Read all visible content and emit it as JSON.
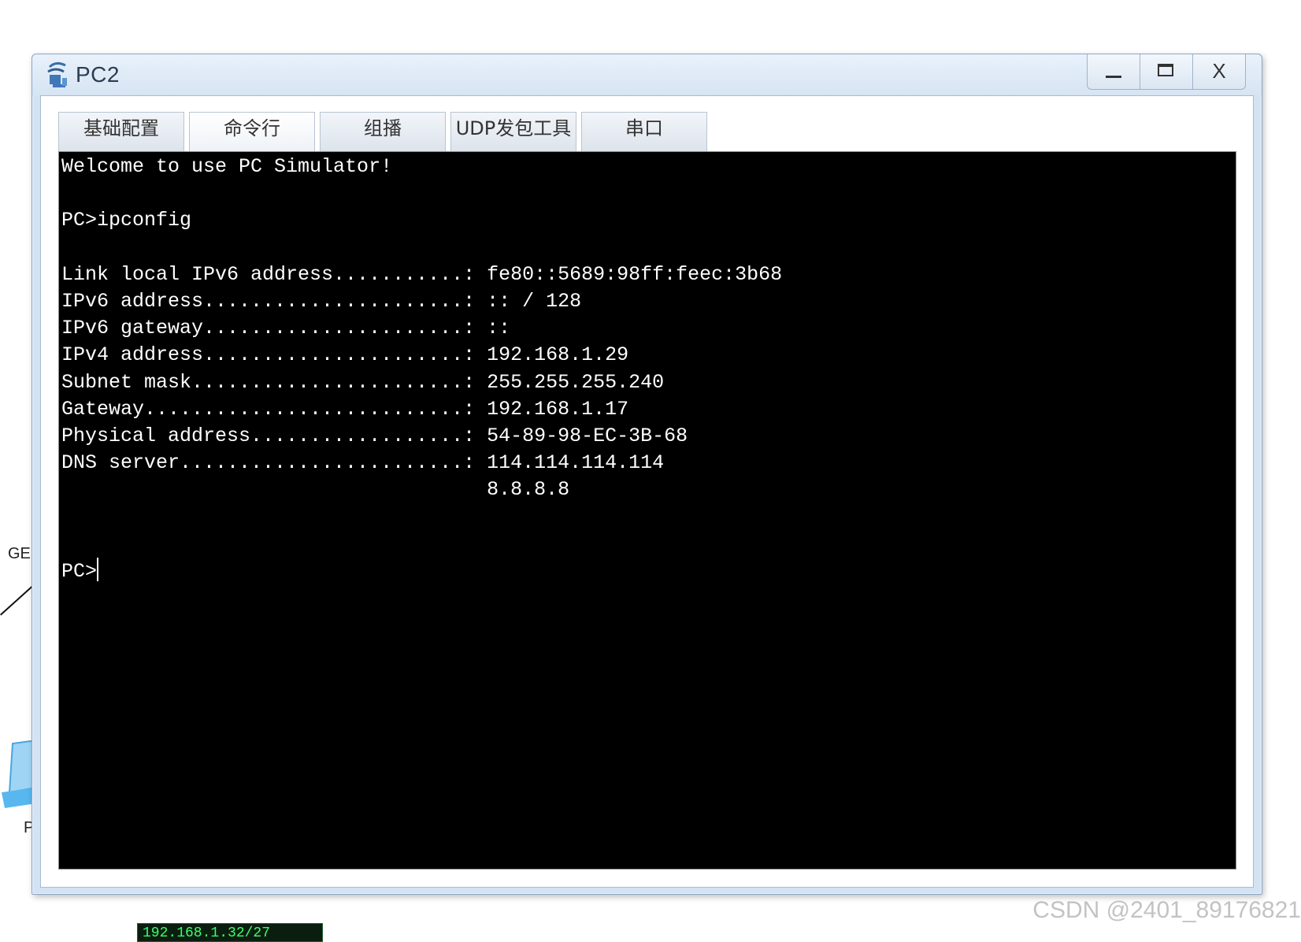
{
  "background": {
    "left_label_top": "GE",
    "left_label_bottom": "P",
    "ip_tag": "192.168.1.32/27",
    "watermark": "CSDN @2401_89176821"
  },
  "window": {
    "title": "PC2",
    "app_icon": "pc-network-icon",
    "controls": {
      "minimize_icon": "minimize-icon",
      "maximize_icon": "maximize-icon",
      "close_label": "X"
    }
  },
  "tabs": [
    {
      "label": "基础配置",
      "active": false
    },
    {
      "label": "命令行",
      "active": true
    },
    {
      "label": "组播",
      "active": false
    },
    {
      "label": "UDP发包工具",
      "active": false
    },
    {
      "label": "串口",
      "active": false
    }
  ],
  "console": {
    "lines": [
      "Welcome to use PC Simulator!",
      "",
      "PC>ipconfig",
      "",
      "Link local IPv6 address...........: fe80::5689:98ff:feec:3b68",
      "IPv6 address......................: :: / 128",
      "IPv6 gateway......................: ::",
      "IPv4 address......................: 192.168.1.29",
      "Subnet mask.......................: 255.255.255.240",
      "Gateway...........................: 192.168.1.17",
      "Physical address..................: 54-89-98-EC-3B-68",
      "DNS server........................: 114.114.114.114",
      "                                    8.8.8.8",
      "",
      ""
    ],
    "prompt": "PC>"
  }
}
